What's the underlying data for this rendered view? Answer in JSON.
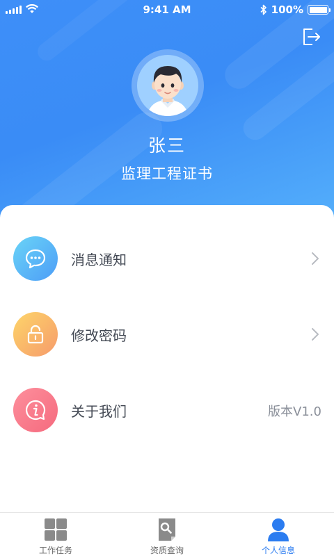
{
  "status_bar": {
    "time": "9:41 AM",
    "battery": "100%"
  },
  "profile": {
    "name": "张三",
    "certificate": "监理工程证书"
  },
  "menu": [
    {
      "label": "消息通知",
      "icon": "message-icon",
      "value": ""
    },
    {
      "label": "修改密码",
      "icon": "lock-icon",
      "value": ""
    },
    {
      "label": "关于我们",
      "icon": "info-icon",
      "value": "版本V1.0"
    }
  ],
  "tabs": [
    {
      "label": "工作任务",
      "icon": "grid-icon",
      "active": false
    },
    {
      "label": "资质查询",
      "icon": "document-search-icon",
      "active": false
    },
    {
      "label": "个人信息",
      "icon": "person-icon",
      "active": true
    }
  ],
  "colors": {
    "header_start": "#3e8ff8",
    "header_end": "#55b0fb",
    "active_tab": "#2b7cf0",
    "inactive_tab_icon": "#8a8a8a"
  }
}
